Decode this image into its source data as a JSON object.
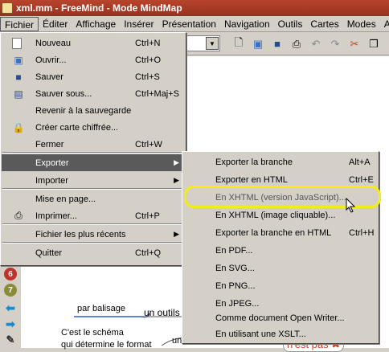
{
  "window": {
    "title": "xml.mm - FreeMind - Mode MindMap"
  },
  "menubar": {
    "items": [
      "Fichier",
      "Éditer",
      "Affichage",
      "Insérer",
      "Présentation",
      "Navigation",
      "Outils",
      "Cartes",
      "Modes",
      "Aide"
    ]
  },
  "file_menu": {
    "items": [
      {
        "label": "Nouveau",
        "shortcut": "Ctrl+N",
        "icon": "new-file-icon"
      },
      {
        "label": "Ouvrir...",
        "shortcut": "Ctrl+O",
        "icon": "open-folder-icon"
      },
      {
        "label": "Sauver",
        "shortcut": "Ctrl+S",
        "icon": "save-icon"
      },
      {
        "label": "Sauver sous...",
        "shortcut": "Ctrl+Maj+S",
        "icon": "save-as-icon"
      },
      {
        "label": "Revenir à la sauvegarde",
        "shortcut": ""
      },
      {
        "label": "Créer carte chiffrée...",
        "shortcut": "",
        "icon": "lock-icon"
      },
      {
        "label": "Fermer",
        "shortcut": "Ctrl+W"
      },
      {
        "label": "Exporter",
        "shortcut": "",
        "submenu": true
      },
      {
        "label": "Importer",
        "shortcut": "",
        "submenu": true
      },
      {
        "label": "Mise en page...",
        "shortcut": ""
      },
      {
        "label": "Imprimer...",
        "shortcut": "Ctrl+P",
        "icon": "printer-icon"
      },
      {
        "label": "Fichier les plus récents",
        "shortcut": "",
        "submenu": true
      },
      {
        "label": "Quitter",
        "shortcut": "Ctrl+Q"
      }
    ]
  },
  "export_submenu": {
    "items": [
      {
        "label": "Exporter la branche",
        "shortcut": "Alt+A"
      },
      {
        "label": "Exporter en HTML",
        "shortcut": "Ctrl+E"
      },
      {
        "label": "En XHTML (version JavaScript)...",
        "shortcut": ""
      },
      {
        "label": "En XHTML (image cliquable)...",
        "shortcut": ""
      },
      {
        "label": "Exporter la branche en HTML",
        "shortcut": "Ctrl+H"
      },
      {
        "label": "En PDF...",
        "shortcut": ""
      },
      {
        "label": "En SVG...",
        "shortcut": ""
      },
      {
        "label": "En PNG...",
        "shortcut": ""
      },
      {
        "label": "En JPEG...",
        "shortcut": ""
      },
      {
        "label": "Comme document Open Writer...",
        "shortcut": ""
      },
      {
        "label": "En utilisant une XSLT...",
        "shortcut": ""
      }
    ]
  },
  "left_icons": [
    "6",
    "7"
  ],
  "canvas": {
    "node1": "par balisage",
    "node2": "un outils",
    "note_line1": "C'est le schéma",
    "note_line2": "qui détermine le format",
    "node3": "un",
    "node4": "n'est pas"
  },
  "colors": {
    "title_bar": "#a63a26",
    "highlight": "#5a5a5a",
    "callout": "#f2ee14"
  }
}
